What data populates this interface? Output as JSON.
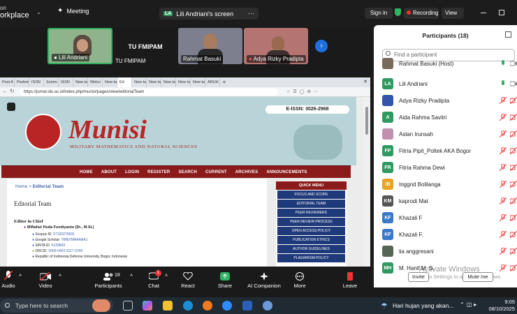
{
  "zoom": {
    "brand": "orkplace",
    "meeting_tab": "Meeting",
    "share_tab_initials": "LA",
    "share_tab": "Lili Andriani's screen",
    "sign_in": "Sign in",
    "recording": "Recording",
    "view": "View"
  },
  "videos": [
    {
      "name": "Lili Andriani"
    },
    {
      "name": "TU FMIPAM",
      "caption": "TU FMIPAM"
    },
    {
      "name": "Rahmat Basuki"
    },
    {
      "name": "Adya Rizky Pradipta"
    }
  ],
  "browser": {
    "tabs": [
      "Post A",
      "Pedom",
      "ISSN",
      "Summ",
      "ISSN",
      "New ta",
      "Welco",
      "New ta",
      "Ed",
      "New ta",
      "New ta",
      "New ta",
      "New ta",
      "New ta",
      "ARUH"
    ],
    "url": "https://jurnal.idu.ac.id/index.php/munisi/pages/view/editorialTeam"
  },
  "site": {
    "eissn": "E-ISSN: 3026-2968",
    "logo_title": "Munisi",
    "logo_subtitle": "MILITARY MATHEMATICS AND NATURAL SCIENCES",
    "nav": [
      "HOME",
      "ABOUT",
      "LOGIN",
      "REGISTER",
      "SEARCH",
      "CURRENT",
      "ARCHIVES",
      "ANNOUNCEMENTS"
    ],
    "breadcrumb_home": "Home",
    "breadcrumb_sep": ">",
    "breadcrumb_current": "Editorial Team",
    "heading": "Editorial Team",
    "section": "Editor in Chief",
    "editor_name": "Miftahul Huda Fendiyanto (Dr., M.Si.)",
    "details": [
      {
        "label": "Scopus ID:",
        "value": "57192275631"
      },
      {
        "label": "Google Scholar:",
        "value": "Y8RjYMAAAAAJ"
      },
      {
        "label": "SINTA ID:",
        "value": "6129843"
      },
      {
        "label": "ORCID:",
        "value": "0000-0002-3117-2240"
      },
      {
        "label": "",
        "value": "Republic of Indonesia Defense University, Bogor, Indonesia"
      }
    ],
    "quick_menu_title": "QUICK MENU",
    "quick_menu": [
      "FOCUS AND SCOPE",
      "EDITORIAL TEAM",
      "PEER REVIEWERS",
      "PEER REVIEW PROCESS",
      "OPEN ACCESS POLICY",
      "PUBLICATION ETHICS",
      "AUTHOR GUIDELINES",
      "PLAGIARISM POLICY"
    ]
  },
  "participants": {
    "title": "Participants (18)",
    "search_placeholder": "Find a participant",
    "list": [
      {
        "initials": "",
        "name": "Rahmat Basuki (Host)",
        "color": "#7a6a5a",
        "muted": false
      },
      {
        "initials": "LA",
        "name": "Lili Andriani",
        "color": "#2f9a5f",
        "muted": false
      },
      {
        "initials": "",
        "name": "Adya Rizky Pradipta",
        "color": "#3355aa",
        "muted": true
      },
      {
        "initials": "A",
        "name": "Aida Rahma Savitri",
        "color": "#2f9a5f",
        "muted": true
      },
      {
        "initials": "",
        "name": "Aslan Irunsah",
        "color": "#c28fb0",
        "muted": true
      },
      {
        "initials": "FP",
        "name": "Fitria Pipit_Poltek AKA Bogor",
        "color": "#2f9a5f",
        "muted": true
      },
      {
        "initials": "FR",
        "name": "Fitria Rahma Dewi",
        "color": "#2f9a5f",
        "muted": true
      },
      {
        "initials": "IB",
        "name": "Inggrid Bolilanga",
        "color": "#e8a422",
        "muted": true
      },
      {
        "initials": "KM",
        "name": "kaprodi Mat",
        "color": "#555555",
        "muted": true
      },
      {
        "initials": "KF",
        "name": "Khazali F",
        "color": "#3a78c8",
        "muted": true
      },
      {
        "initials": "KF",
        "name": "Khazali F.",
        "color": "#3a78c8",
        "muted": true
      },
      {
        "initials": "",
        "name": "lia anggresani",
        "color": "#556655",
        "muted": true
      },
      {
        "initials": "MH",
        "name": "M. Hanif M. S.",
        "color": "#2f9a5f",
        "muted": true
      }
    ],
    "invite": "Invite",
    "mute_me": "Mute me",
    "watermark_title": "Activate Windows",
    "watermark_sub": "Go to Settings to activate Windows."
  },
  "toolbar": {
    "audio": "Audio",
    "video": "Video",
    "participants": "Participants",
    "participants_count": "18",
    "chat": "Chat",
    "chat_badge": "1",
    "react": "React",
    "share": "Share",
    "ai": "AI Companion",
    "more": "More",
    "leave": "Leave"
  },
  "taskbar": {
    "search": "Type here to search",
    "weather": "Hari hujan yang akan...",
    "time": "9:05",
    "date": "08/10/2025"
  }
}
